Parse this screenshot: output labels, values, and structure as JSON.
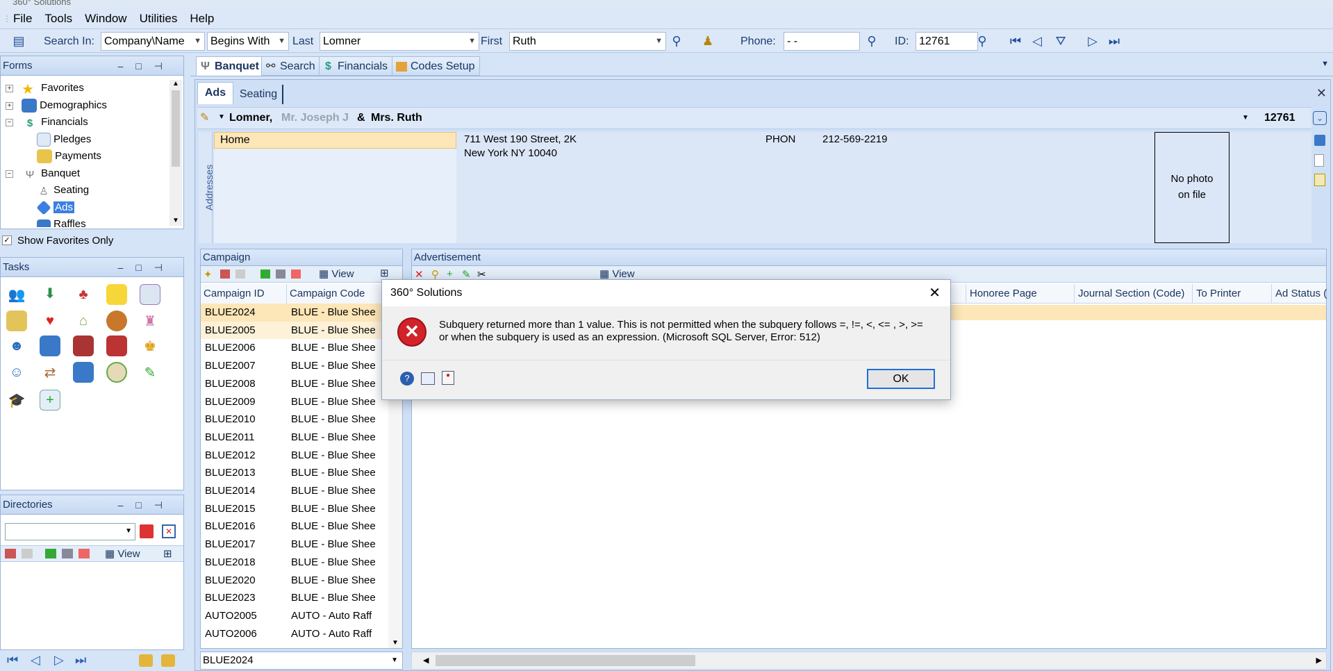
{
  "app": {
    "title": "360° Solutions"
  },
  "menu": [
    "File",
    "Tools",
    "Window",
    "Utilities",
    "Help"
  ],
  "toolbar": {
    "search_in_label": "Search In:",
    "search_in_value": "Company\\Name",
    "match_value": "Begins With",
    "last_label": "Last",
    "last_value": "Lomner",
    "first_label": "First",
    "first_value": "Ruth",
    "phone_label": "Phone:",
    "phone_value": "- -",
    "id_label": "ID:",
    "id_value": "12761"
  },
  "forms": {
    "title": "Forms",
    "items": [
      {
        "label": "Favorites",
        "icon": "star-icon"
      },
      {
        "label": "Demographics",
        "icon": "database-icon"
      },
      {
        "label": "Financials",
        "icon": "dollar-icon"
      },
      {
        "label": "Pledges",
        "icon": "document-icon"
      },
      {
        "label": "Payments",
        "icon": "payment-icon"
      },
      {
        "label": "Banquet",
        "icon": "banquet-icon"
      },
      {
        "label": "Seating",
        "icon": "chair-icon"
      },
      {
        "label": "Ads",
        "icon": "ad-icon"
      },
      {
        "label": "Raffles",
        "icon": "raffle-icon"
      }
    ],
    "show_favorites_label": "Show Favorites Only"
  },
  "tasks": {
    "title": "Tasks"
  },
  "directories": {
    "title": "Directories",
    "view_label": "View"
  },
  "main_tabs": [
    "Banquet",
    "Search",
    "Financials",
    "Codes Setup"
  ],
  "sub_tabs": [
    "Ads",
    "Seating"
  ],
  "record": {
    "last_name": "Lomner,",
    "spouse_name": "Mr. Joseph J",
    "amp": "&",
    "first_name": "Mrs. Ruth",
    "id": "12761"
  },
  "address": {
    "side_label": "Addresses",
    "type": "Home",
    "line1": "711 West 190 Street, 2K",
    "line2": "New York NY 10040",
    "phone_type": "PHON",
    "phone": "212-569-2219",
    "photo_line1": "No photo",
    "photo_line2": "on file"
  },
  "campaign": {
    "title": "Campaign",
    "view_label": "View",
    "columns": [
      "Campaign ID",
      "Campaign Code"
    ],
    "rows": [
      [
        "BLUE2024",
        "BLUE - Blue Shee"
      ],
      [
        "BLUE2005",
        "BLUE - Blue Shee"
      ],
      [
        "BLUE2006",
        "BLUE - Blue Shee"
      ],
      [
        "BLUE2007",
        "BLUE - Blue Shee"
      ],
      [
        "BLUE2008",
        "BLUE - Blue Shee"
      ],
      [
        "BLUE2009",
        "BLUE - Blue Shee"
      ],
      [
        "BLUE2010",
        "BLUE - Blue Shee"
      ],
      [
        "BLUE2011",
        "BLUE - Blue Shee"
      ],
      [
        "BLUE2012",
        "BLUE - Blue Shee"
      ],
      [
        "BLUE2013",
        "BLUE - Blue Shee"
      ],
      [
        "BLUE2014",
        "BLUE - Blue Shee"
      ],
      [
        "BLUE2015",
        "BLUE - Blue Shee"
      ],
      [
        "BLUE2016",
        "BLUE - Blue Shee"
      ],
      [
        "BLUE2017",
        "BLUE - Blue Shee"
      ],
      [
        "BLUE2018",
        "BLUE - Blue Shee"
      ],
      [
        "BLUE2020",
        "BLUE - Blue Shee"
      ],
      [
        "BLUE2023",
        "BLUE - Blue Shee"
      ],
      [
        "AUTO2005",
        "AUTO - Auto Raff"
      ],
      [
        "AUTO2006",
        "AUTO - Auto Raff"
      ]
    ],
    "selected": "BLUE2024"
  },
  "advertisement": {
    "title": "Advertisement",
    "view_label": "View",
    "columns": [
      "Honoree Page",
      "Journal Section (Code)",
      "To Printer",
      "Ad Status (C"
    ]
  },
  "dialog": {
    "title": "360° Solutions",
    "message": "Subquery returned more than 1 value. This is not permitted when the subquery follows =, !=, <, <= , >, >= or when the subquery is used as an expression. (Microsoft SQL Server, Error: 512)",
    "ok_label": "OK"
  },
  "colors": {
    "highlight_row": "#fde6b8",
    "selected_tree": "#3b7fe0",
    "error_red": "#d2232a"
  }
}
